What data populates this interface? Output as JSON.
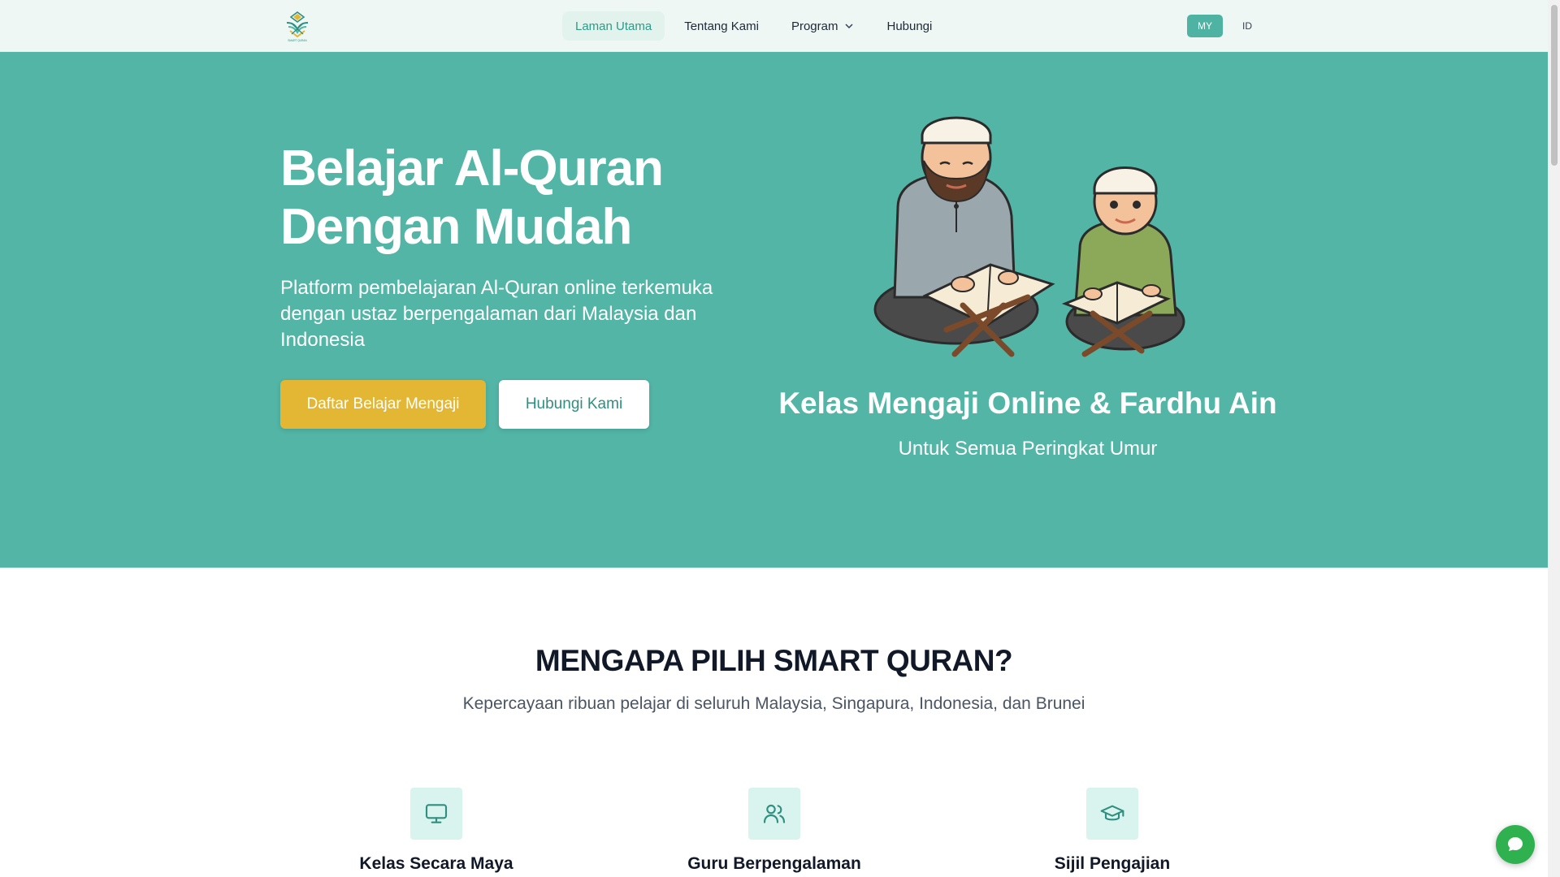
{
  "nav": {
    "logo_icon": "smart-quran-logo",
    "logo_text": "SMART QURAN",
    "links": [
      {
        "label": "Laman Utama",
        "active": true
      },
      {
        "label": "Tentang Kami",
        "active": false
      },
      {
        "label": "Program",
        "active": false,
        "has_dropdown": true
      },
      {
        "label": "Hubungi",
        "active": false
      }
    ],
    "languages": [
      {
        "label": "MY",
        "active": true
      },
      {
        "label": "ID",
        "active": false
      }
    ]
  },
  "hero": {
    "title_line1": "Belajar Al-Quran",
    "title_line2": "Dengan Mudah",
    "subtitle": "Platform pembelajaran Al-Quran online terkemuka dengan ustaz berpengalaman dari Malaysia dan Indonesia",
    "primary_button": "Daftar Belajar Mengaji",
    "secondary_button": "Hubungi Kami",
    "right_title": "Kelas Mengaji Online & Fardhu Ain",
    "right_subtitle": "Untuk Semua Peringkat Umur",
    "illustration": "teacher-and-child-reading-quran"
  },
  "why": {
    "title": "MENGAPA PILIH SMART QURAN?",
    "subtitle": "Kepercayaan ribuan pelajar di seluruh Malaysia, Singapura, Indonesia, dan Brunei",
    "features": [
      {
        "icon": "monitor-icon",
        "label": "Kelas Secara Maya"
      },
      {
        "icon": "users-icon",
        "label": "Guru Berpengalaman"
      },
      {
        "icon": "graduation-cap-icon",
        "label": "Sijil Pengajian"
      }
    ]
  },
  "colors": {
    "hero_bg": "#52b5a6",
    "nav_bg": "#eef7f4",
    "primary_button": "#e3b733",
    "accent": "#4fb3a4",
    "chat_button": "#2fb14f"
  },
  "chat": {
    "icon": "chat-bubble-icon"
  }
}
